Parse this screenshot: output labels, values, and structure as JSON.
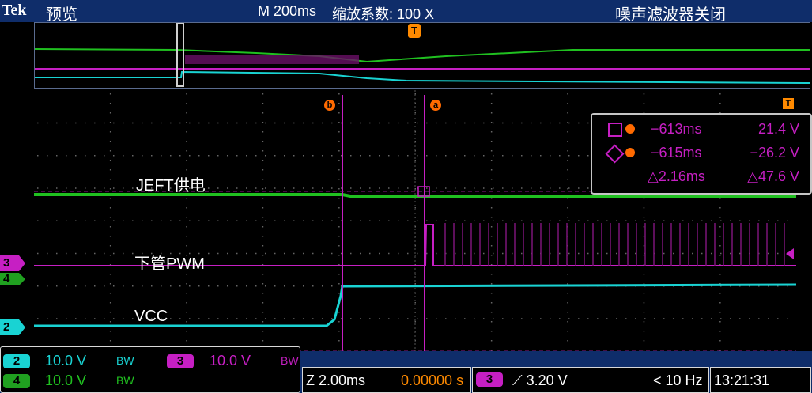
{
  "header": {
    "brand": "Tek",
    "mode": "预览",
    "timebase": "M 200ms",
    "zoom": "缩放系数: 100 X",
    "noise_filter": "噪声滤波器关闭"
  },
  "traces": {
    "jeft_label": "JEFT供电",
    "pwm_label": "下管PWM",
    "vcc_label": "VCC"
  },
  "markers": {
    "channel_3": "3",
    "channel_4": "4",
    "channel_2": "2",
    "cursor_a": "a",
    "cursor_b": "b",
    "trigger_t": "T"
  },
  "cursor_readout": {
    "a_time": "−613ms",
    "a_value": "21.4 V",
    "b_time": "−615ms",
    "b_value": "−26.2 V",
    "delta_time": "△2.16ms",
    "delta_value": "△47.6 V"
  },
  "status": {
    "ch2_num": "2",
    "ch2_scale": "10.0 V",
    "ch4_num": "4",
    "ch4_scale": "10.0 V",
    "bw_a": "BW",
    "bw_b": "BW",
    "ch3_num": "3",
    "ch3_scale": "10.0 V",
    "bw_c": "BW",
    "zoom_scale": "Z 2.00ms",
    "zoom_pos": "0.00000 s",
    "trig_ch": "3",
    "trig_level": "⟋ 3.20 V",
    "trig_freq": "< 10 Hz",
    "clock": "13:21:31"
  },
  "colors": {
    "ch2": "#19d3d3",
    "ch3": "#c61fc3",
    "ch4": "#20c020",
    "cursor": "#ff6a00",
    "header_bg": "#0f2d6a"
  }
}
